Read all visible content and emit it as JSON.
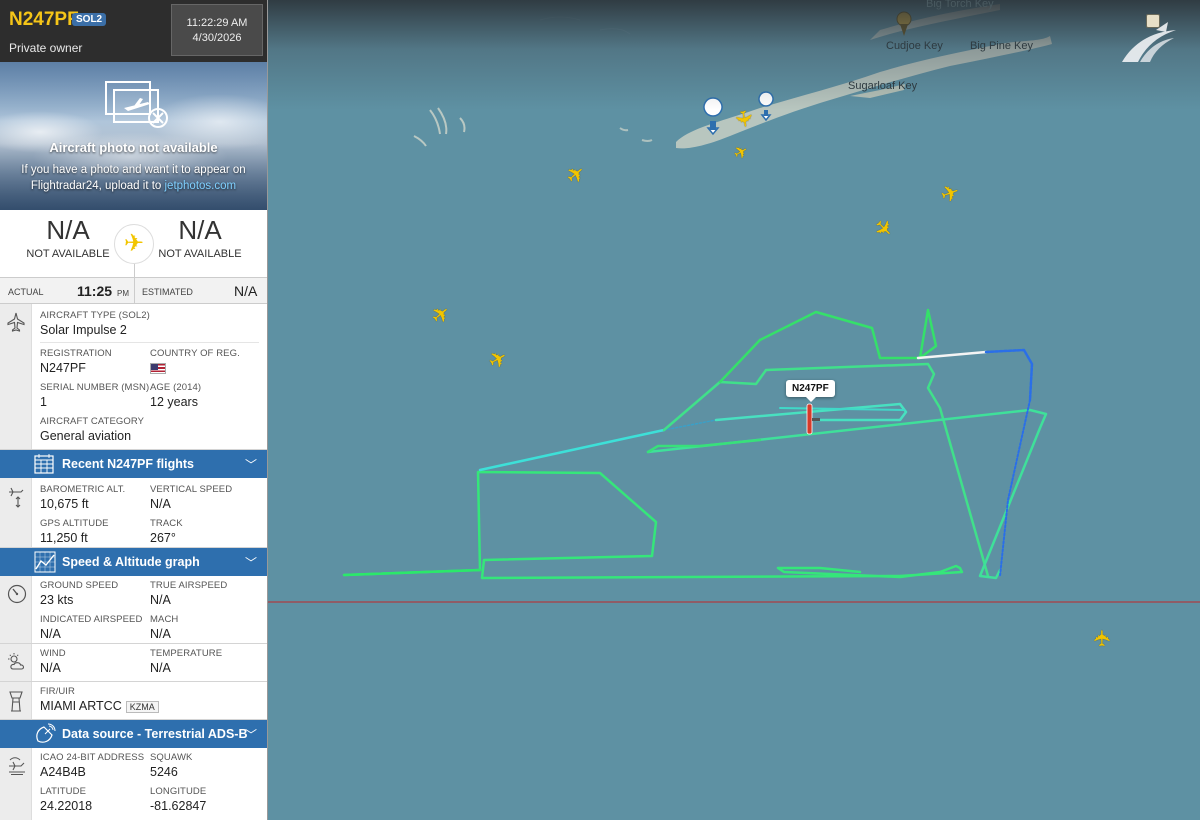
{
  "flight": {
    "callsign": "N247PF",
    "type_badge": "SOL2",
    "owner": "Private owner",
    "time": "11:22:29 AM",
    "date": "4/30/2026"
  },
  "photo": {
    "title": "Aircraft photo not available",
    "text_before": "If you have a photo and want it to appear on Flightradar24, upload it to ",
    "link": "jetphotos.com"
  },
  "route": {
    "origin_code": "N/A",
    "origin_sub": "NOT AVAILABLE",
    "dest_code": "N/A",
    "dest_sub": "NOT AVAILABLE"
  },
  "times": {
    "actual_label": "ACTUAL",
    "actual_value": "11:25",
    "actual_suffix": "PM",
    "estimated_label": "ESTIMATED",
    "estimated_value": "N/A"
  },
  "aircraft": {
    "type_label": "AIRCRAFT TYPE (SOL2)",
    "type_value": "Solar Impulse 2",
    "reg_label": "REGISTRATION",
    "reg_value": "N247PF",
    "country_label": "COUNTRY OF REG.",
    "serial_label": "SERIAL NUMBER (MSN)",
    "serial_value": "1",
    "age_label": "AGE (2014)",
    "age_value": "12 years",
    "category_label": "AIRCRAFT CATEGORY",
    "category_value": "General aviation"
  },
  "bars": {
    "recent": "Recent N247PF flights",
    "graph": "Speed & Altitude graph",
    "source": "Data source - Terrestrial ADS-B"
  },
  "altitude": {
    "baro_label": "BAROMETRIC ALT.",
    "baro_value": "10,675 ft",
    "vs_label": "VERTICAL SPEED",
    "vs_value": "N/A",
    "gps_label": "GPS ALTITUDE",
    "gps_value": "11,250 ft",
    "track_label": "TRACK",
    "track_value": "267°"
  },
  "speed": {
    "gs_label": "GROUND SPEED",
    "gs_value": "23 kts",
    "tas_label": "TRUE AIRSPEED",
    "tas_value": "N/A",
    "ias_label": "INDICATED AIRSPEED",
    "ias_value": "N/A",
    "mach_label": "MACH",
    "mach_value": "N/A"
  },
  "weather": {
    "wind_label": "WIND",
    "wind_value": "N/A",
    "temp_label": "TEMPERATURE",
    "temp_value": "N/A"
  },
  "fir": {
    "label": "FIR/UIR",
    "value": "MIAMI ARTCC",
    "code": "KZMA"
  },
  "source": {
    "icao_label": "ICAO 24-BIT ADDRESS",
    "icao_value": "A24B4B",
    "squawk_label": "SQUAWK",
    "squawk_value": "5246",
    "lat_label": "LATITUDE",
    "lat_value": "24.22018",
    "lon_label": "LONGITUDE",
    "lon_value": "-81.62847"
  },
  "map": {
    "places": {
      "cudjoe": "Cudjoe Key",
      "bigpine": "Big Pine Key",
      "sugarloaf": "Sugarloaf Key",
      "bigtorch": "Big Torch Key"
    },
    "aircraft_tag": "N247PF",
    "colors": {
      "track_green": "#33e06a",
      "track_cyan": "#3de0d8",
      "track_blue": "#2a6fe8",
      "water": "#5e91a3",
      "land": "#c8cfc4",
      "header_blue": "#2e6fae",
      "callsign": "#f5c518"
    }
  }
}
